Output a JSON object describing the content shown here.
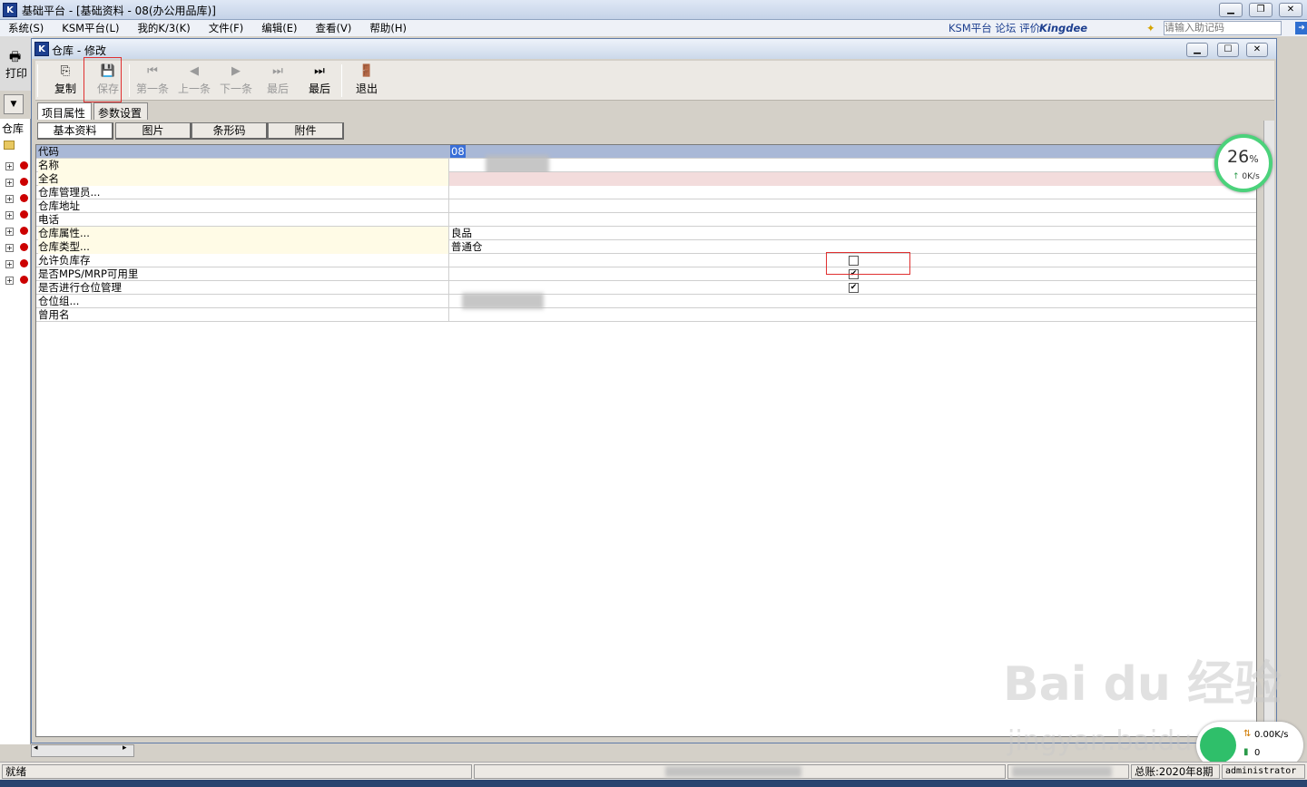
{
  "app": {
    "title": "基础平台 - [基础资料 - 08(办公用品库)]",
    "logo": "K"
  },
  "menu": [
    "系统(S)",
    "KSM平台(L)",
    "我的K/3(K)",
    "文件(F)",
    "编辑(E)",
    "查看(V)",
    "帮助(H)"
  ],
  "menu_right": {
    "links": "KSM平台  论坛  评价",
    "brand": "Kingdee",
    "memo_placeholder": "请输入助记码"
  },
  "outer_toolbar": {
    "print": "打印"
  },
  "left_tree": {
    "header": "仓库"
  },
  "window": {
    "title": "仓库 - 修改",
    "logo": "K"
  },
  "toolbar": [
    {
      "label": "复制",
      "icon": "copy-icon",
      "glyph": "⎘",
      "enabled": true
    },
    {
      "label": "保存",
      "icon": "save-icon",
      "glyph": "💾",
      "enabled": false
    },
    {
      "label": "第一条",
      "icon": "first-icon",
      "glyph": "⏮",
      "enabled": false
    },
    {
      "label": "上一条",
      "icon": "prev-icon",
      "glyph": "◀",
      "enabled": false
    },
    {
      "label": "下一条",
      "icon": "next-icon",
      "glyph": "▶",
      "enabled": false
    },
    {
      "label": "最后",
      "icon": "last-icon",
      "glyph": "⏭",
      "enabled": false
    },
    {
      "label": "最后",
      "icon": "last-icon",
      "glyph": "⏭",
      "enabled": true
    },
    {
      "label": "退出",
      "icon": "exit-icon",
      "glyph": "🚪",
      "enabled": true
    }
  ],
  "tabs_top": [
    "项目属性",
    "参数设置"
  ],
  "tabs_sub": [
    "基本资料",
    "图片",
    "条形码",
    "附件"
  ],
  "fields": [
    {
      "label": "代码",
      "value": "08",
      "type": "header"
    },
    {
      "label": "名称",
      "value": "",
      "type": "blurred",
      "required": true
    },
    {
      "label": "全名",
      "value": "",
      "type": "text",
      "required": true
    },
    {
      "label": "仓库管理员...",
      "value": "",
      "type": "text",
      "required": false
    },
    {
      "label": "仓库地址",
      "value": "",
      "type": "text",
      "required": false
    },
    {
      "label": "电话",
      "value": "",
      "type": "text",
      "required": false
    },
    {
      "label": "仓库属性...",
      "value": "良品",
      "type": "text",
      "required": true
    },
    {
      "label": "仓库类型...",
      "value": "普通仓",
      "type": "text",
      "required": true
    },
    {
      "label": "允许负库存",
      "value": "",
      "type": "checkbox",
      "checked": false
    },
    {
      "label": "是否MPS/MRP可用里",
      "value": "",
      "type": "checkbox",
      "checked": true
    },
    {
      "label": "是否进行仓位管理",
      "value": "",
      "type": "checkbox",
      "checked": true
    },
    {
      "label": "仓位组...",
      "value": "",
      "type": "blurred",
      "required": false
    },
    {
      "label": "曾用名",
      "value": "",
      "type": "text",
      "required": false
    }
  ],
  "gauge": {
    "percent": "26",
    "unit": "%",
    "speed": "0K/s"
  },
  "network": {
    "up": "0.00K/s",
    "down": "0"
  },
  "status": {
    "ready": "就绪",
    "period": "总账:2020年8期",
    "user": "administrator"
  },
  "watermark": {
    "brand": "Bai du 经验",
    "url": "jingyan.baidu.com"
  }
}
